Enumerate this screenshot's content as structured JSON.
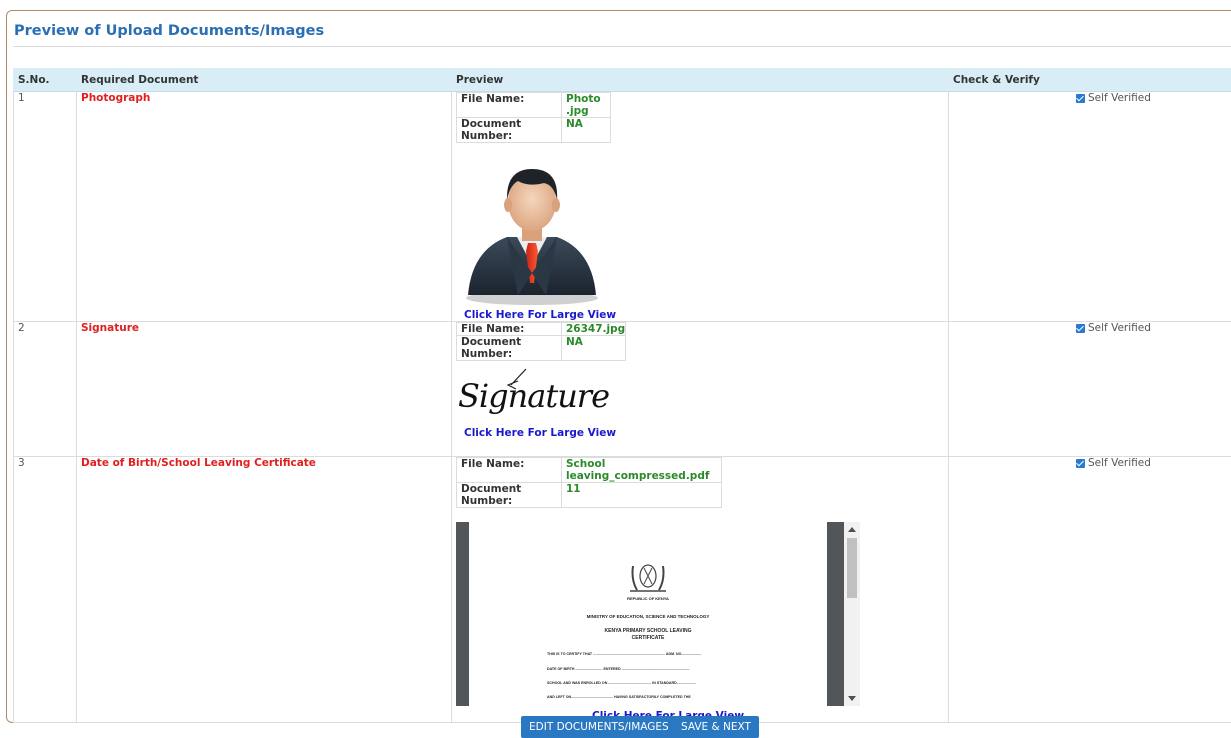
{
  "title": "Preview of Upload Documents/Images",
  "table": {
    "headers": [
      "S.No.",
      "Required Document",
      "Preview",
      "Check & Verify"
    ],
    "file_name_label": "File Name:",
    "doc_number_label": "Document Number:",
    "large_view_label": "Click Here For Large View",
    "verify_label": "Self Verified",
    "rows": [
      {
        "sno": "1",
        "document": "Photograph",
        "file_name": "Photo .jpg",
        "doc_number": "NA",
        "verified": true
      },
      {
        "sno": "2",
        "document": "Signature",
        "file_name": "26347.jpg",
        "doc_number": "NA",
        "verified": true
      },
      {
        "sno": "3",
        "document": "Date of Birth/School Leaving Certificate",
        "file_name": "School leaving_compressed.pdf",
        "doc_number": "11",
        "verified": true
      }
    ]
  },
  "signature_text": "Signature",
  "certificate": {
    "republic": "REPUBLIC OF KENYA",
    "ministry": "MINISTRY OF EDUCATION, SCIENCE AND TECHNOLOGY",
    "heading": "KENYA PRIMARY SCHOOL LEAVING",
    "heading2": "CERTIFICATE",
    "line1": "THIS IS TO CERTIFY THAT ........................................................................ ADM. NO....................",
    "line2": "DATE OF BIRTH ........................... ENTERED ....................................................................",
    "line3": "SCHOOL AND WAS ENROLLED ON ........................................... IN STANDARD...................",
    "line4": "AND LEFT ON.......................................... HAVING SATISFACTORILY COMPLETED THE"
  },
  "buttons": {
    "edit": "EDIT DOCUMENTS/IMAGES",
    "save": "SAVE & NEXT"
  },
  "colors": {
    "title": "#2a6fb3",
    "required_doc": "#e02020",
    "file_value": "#2b8a2b",
    "link": "#1a1acc",
    "header_bg": "#d9edf7",
    "button": "#2a78c2"
  }
}
